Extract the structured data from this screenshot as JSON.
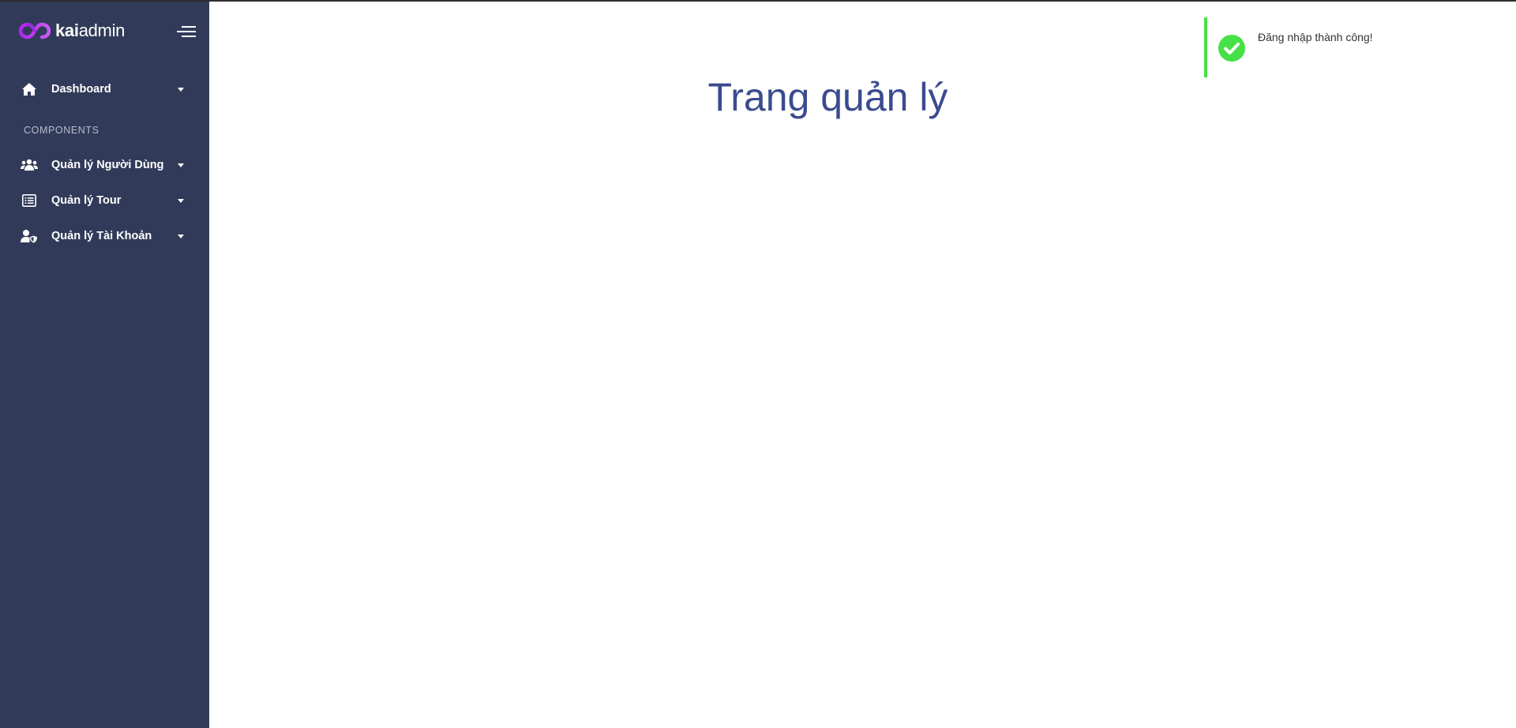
{
  "brand": {
    "name_bold": "kai",
    "name_light": "admin",
    "logo_colors": [
      "#b224ef",
      "#7579ff"
    ]
  },
  "sidebar": {
    "background": "#313b59",
    "toggle_icon": "menu-lines-icon",
    "items": [
      {
        "label": "Dashboard",
        "icon": "home-icon"
      },
      {
        "label": "Quản lý Người Dùng",
        "icon": "users-icon"
      },
      {
        "label": "Quản lý Tour",
        "icon": "list-icon"
      },
      {
        "label": "Quản lý Tài Khoản",
        "icon": "user-shield-icon"
      }
    ],
    "section_label": "COMPONENTS"
  },
  "main": {
    "title": "Trang quản lý",
    "title_color": "#3b4b8f"
  },
  "toast": {
    "title": "Đăng nhập thành công!",
    "subtitle": "",
    "icon": "check-circle-icon",
    "accent": "#46e146"
  }
}
